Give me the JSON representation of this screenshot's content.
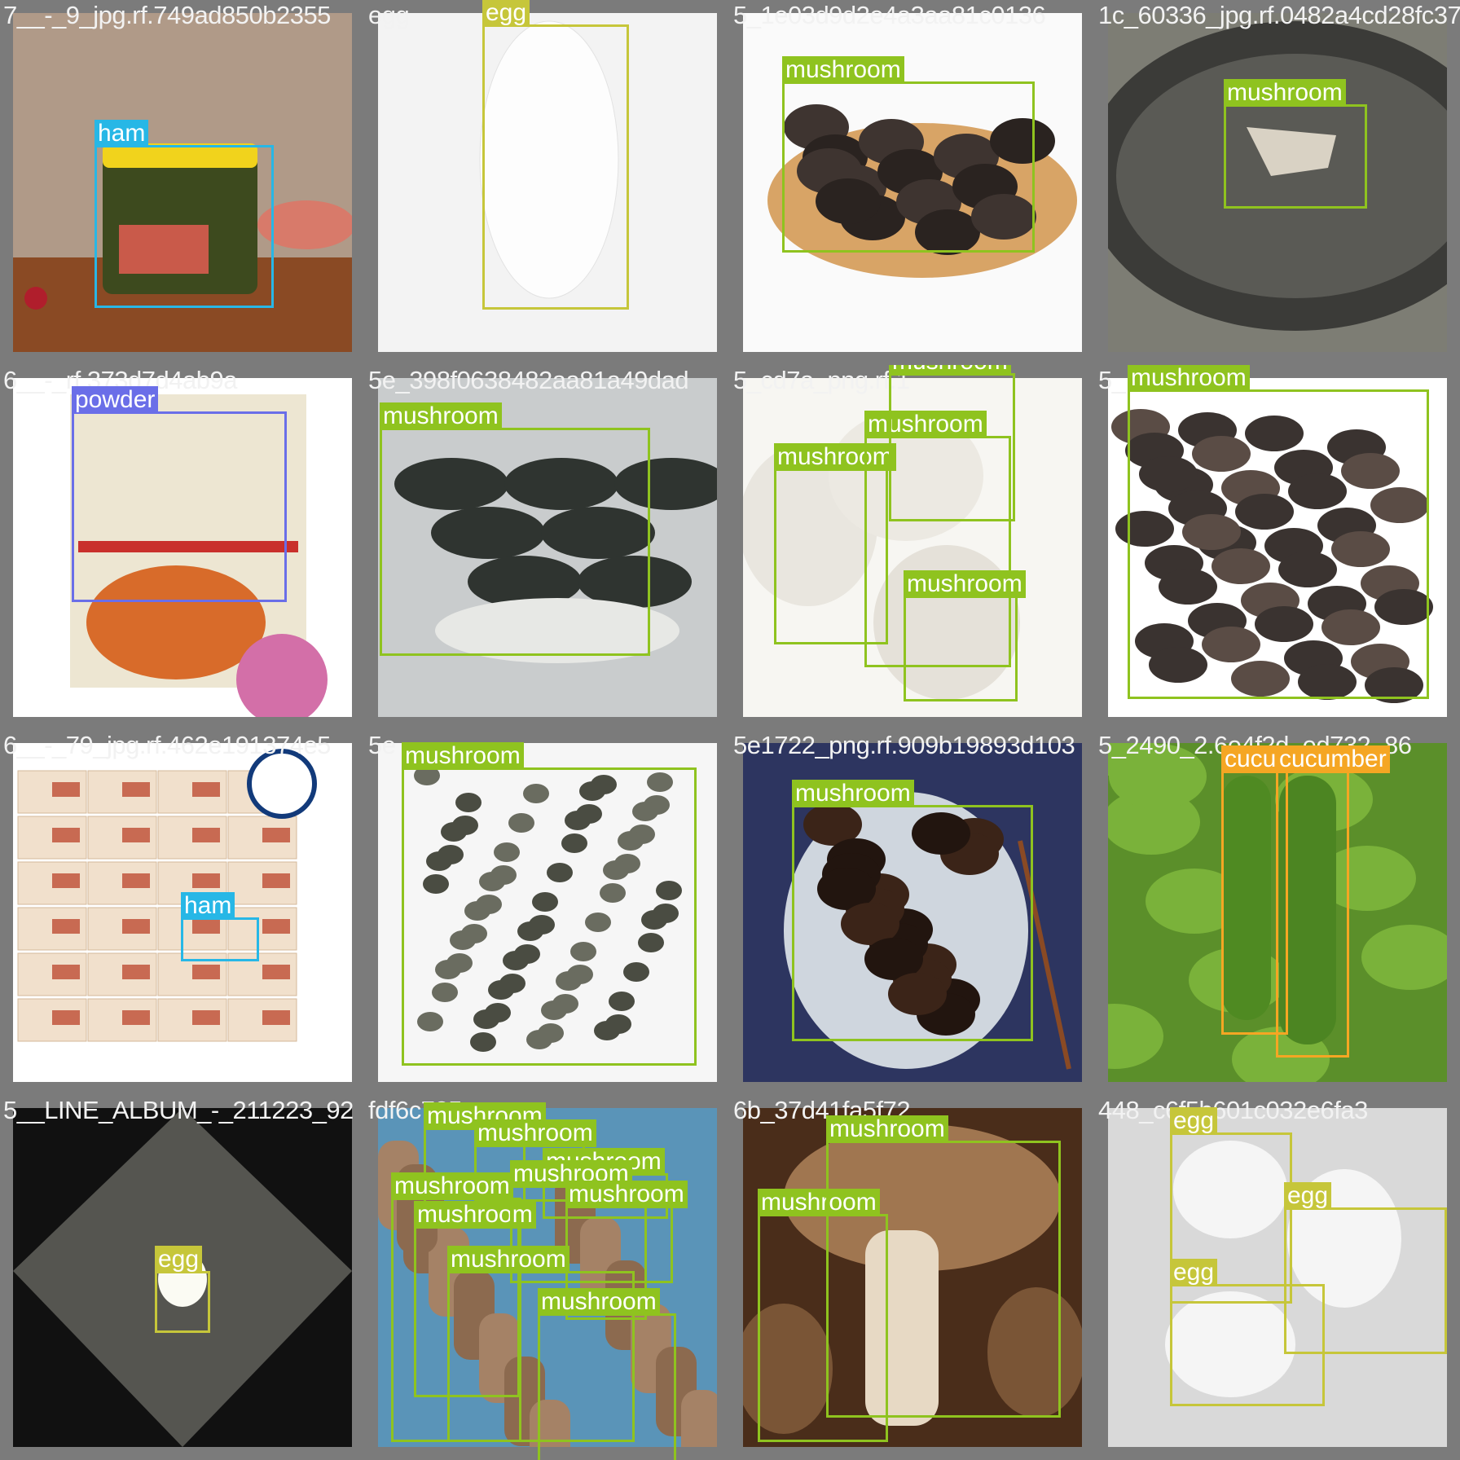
{
  "class_colors": {
    "ham": "#27b7e6",
    "egg": "#c6c63a",
    "mushroom": "#8fc31f",
    "powder": "#6a6ee8",
    "cucumber": "#f5a623"
  },
  "tiles": [
    {
      "filename": "7__-_9_jpg.rf.749ad850b2355",
      "labels": [
        "ham"
      ]
    },
    {
      "filename": "egg",
      "labels": [
        "egg"
      ]
    },
    {
      "filename": "5_1e03d9d2e4a3aa81c0136",
      "labels": [
        "mushroom"
      ]
    },
    {
      "filename": "1c_60336_jpg.rf.0482a4cd28fc37",
      "labels": [
        "mushroom"
      ]
    },
    {
      "filename": "6__-_",
      "suffix": "rf.373d7d4ab9a",
      "labels": [
        "powder"
      ]
    },
    {
      "filename": "5e_398f0638482aa81a49dad",
      "labels": [
        "mushroom"
      ]
    },
    {
      "filename": "5_cd7a_png.rf.1",
      "labels": [
        "mushroom",
        "mushroom",
        "mushroom",
        "mushroom"
      ]
    },
    {
      "filename": "5_",
      "labels": [
        "mushroom"
      ]
    },
    {
      "filename": "6__-_79_jpg.rf.462e191374e5",
      "labels": [
        "ham"
      ]
    },
    {
      "filename": "5e",
      "labels": [
        "mushroom"
      ]
    },
    {
      "filename": "5e1722_png.rf.909b19893d103",
      "labels": [
        "mushroom"
      ]
    },
    {
      "filename": "5_2490_2.6e4f2d_ed732_86",
      "labels": [
        "cucumber",
        "cucumber"
      ]
    },
    {
      "filename": "5__LINE_ALBUM_-_211223_92",
      "labels": [
        "egg"
      ]
    },
    {
      "filename": "fdf6c785ae",
      "labels": [
        "mushroom",
        "mushroom",
        "mushroom",
        "mushroom",
        "mushroom",
        "mushroom",
        "mushroom",
        "mushroom",
        "mushroom"
      ]
    },
    {
      "filename": "6b_37d41fa5f72",
      "labels": [
        "mushroom",
        "mushroom"
      ]
    },
    {
      "filename": "448_c6f5b601c032e6fa3",
      "labels": [
        "egg",
        "egg",
        "egg"
      ]
    }
  ]
}
